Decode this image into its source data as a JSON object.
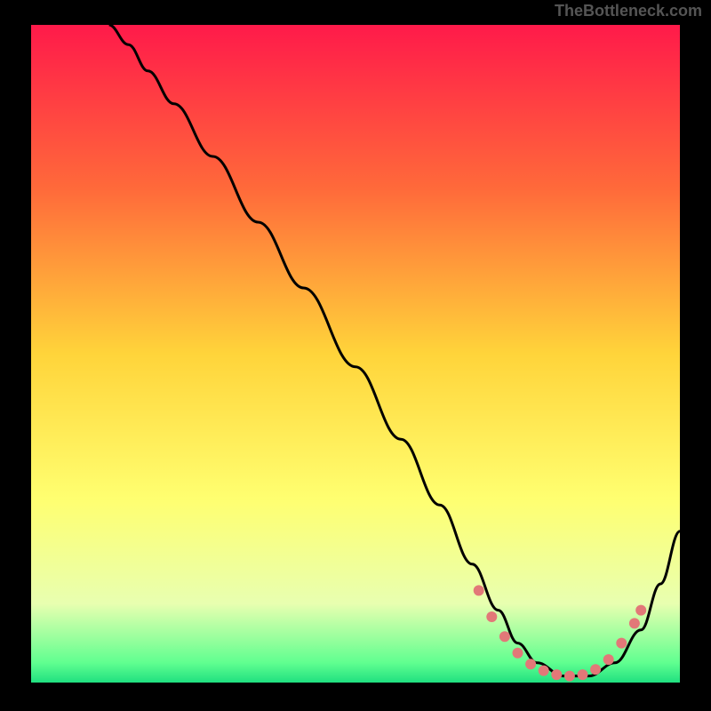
{
  "watermark": "TheBottleneck.com",
  "chart_data": {
    "type": "line",
    "title": "",
    "xlabel": "",
    "ylabel": "",
    "xlim": [
      0,
      100
    ],
    "ylim": [
      0,
      100
    ],
    "background_gradient": {
      "stops": [
        {
          "offset": 0,
          "color": "#ff1a4a"
        },
        {
          "offset": 25,
          "color": "#ff6a3a"
        },
        {
          "offset": 50,
          "color": "#ffd43a"
        },
        {
          "offset": 72,
          "color": "#ffff70"
        },
        {
          "offset": 88,
          "color": "#e8ffb0"
        },
        {
          "offset": 97,
          "color": "#60ff90"
        },
        {
          "offset": 100,
          "color": "#20e080"
        }
      ]
    },
    "series": [
      {
        "name": "curve",
        "x": [
          12,
          15,
          18,
          22,
          28,
          35,
          42,
          50,
          57,
          63,
          68,
          72,
          75,
          78,
          82,
          86,
          90,
          94,
          97,
          100
        ],
        "y": [
          100,
          97,
          93,
          88,
          80,
          70,
          60,
          48,
          37,
          27,
          18,
          11,
          6,
          3,
          1,
          1,
          3,
          8,
          15,
          23
        ]
      }
    ],
    "markers": {
      "name": "dotted-region",
      "color": "#e27878",
      "points": [
        {
          "x": 69,
          "y": 14
        },
        {
          "x": 71,
          "y": 10
        },
        {
          "x": 73,
          "y": 7
        },
        {
          "x": 75,
          "y": 4.5
        },
        {
          "x": 77,
          "y": 2.8
        },
        {
          "x": 79,
          "y": 1.8
        },
        {
          "x": 81,
          "y": 1.2
        },
        {
          "x": 83,
          "y": 1.0
        },
        {
          "x": 85,
          "y": 1.2
        },
        {
          "x": 87,
          "y": 2.0
        },
        {
          "x": 89,
          "y": 3.5
        },
        {
          "x": 91,
          "y": 6.0
        },
        {
          "x": 93,
          "y": 9.0
        },
        {
          "x": 94,
          "y": 11.0
        }
      ]
    }
  }
}
